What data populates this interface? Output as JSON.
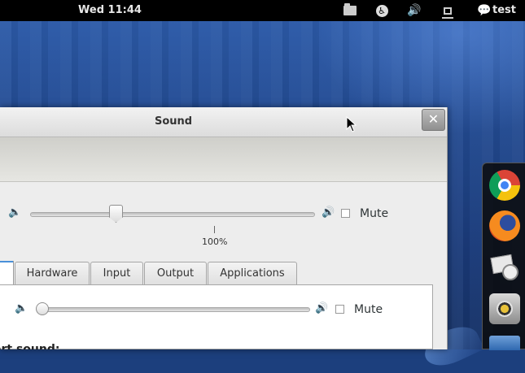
{
  "topbar": {
    "clock": "Wed 11:44",
    "username": "test",
    "icons": [
      "folder-icon",
      "accessibility-icon",
      "volume-icon",
      "network-icon",
      "chat-icon"
    ]
  },
  "window": {
    "title": "Sound",
    "close_glyph": "✕"
  },
  "output_volume": {
    "level_label": "100%",
    "level_fraction": 0.31,
    "mute_label": "Mute",
    "muted": false
  },
  "tabs": [
    {
      "label": "Hardware"
    },
    {
      "label": "Input"
    },
    {
      "label": "Output"
    },
    {
      "label": "Applications"
    }
  ],
  "input_volume": {
    "mute_label": "Mute",
    "level_fraction": 0.0,
    "muted": false
  },
  "alert": {
    "label": "ert sound:"
  },
  "dash": {
    "apps": [
      "chrome-icon",
      "firefox-icon",
      "evolution-icon",
      "rhythmbox-icon",
      "files-icon"
    ]
  }
}
